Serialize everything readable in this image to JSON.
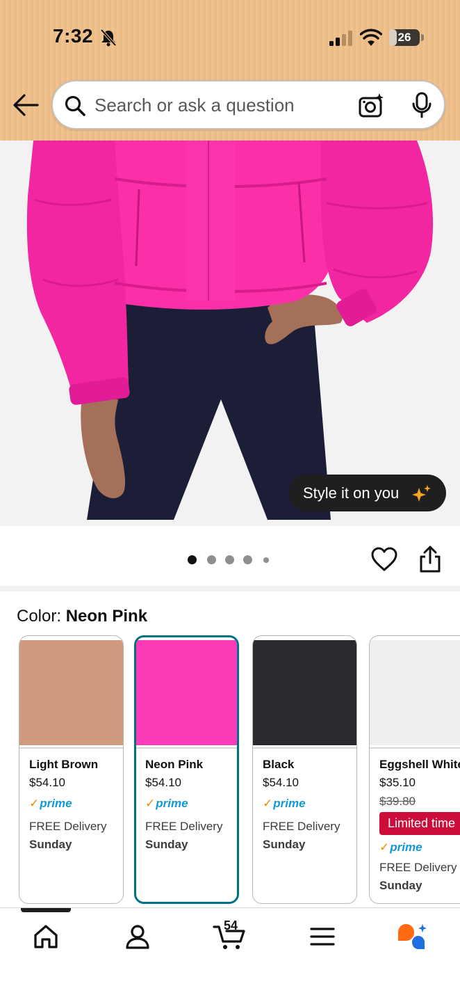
{
  "status_bar": {
    "time": "7:32",
    "battery": "26",
    "battery_level": 0.26
  },
  "search": {
    "placeholder": "Search or ask a question"
  },
  "product": {
    "style_button_label": "Style it on you",
    "image_dots": 5,
    "active_dot": 0
  },
  "color_selector": {
    "label": "Color: ",
    "selected": "Neon Pink",
    "options": [
      {
        "name": "Light Brown",
        "price": "$54.10",
        "prime": "prime",
        "delivery": "FREE Delivery",
        "day": "Sunday",
        "swatch": "#cf9a7f"
      },
      {
        "name": "Neon Pink",
        "price": "$54.10",
        "prime": "prime",
        "delivery": "FREE Delivery",
        "day": "Sunday",
        "swatch": "#fb3cb8"
      },
      {
        "name": "Black",
        "price": "$54.10",
        "prime": "prime",
        "delivery": "FREE Delivery",
        "day": "Sunday",
        "swatch": "#2b2a30"
      },
      {
        "name": "Eggshell White",
        "price": "$35.10",
        "list_price": "$39.80",
        "deal": "Limited time",
        "prime": "prime",
        "delivery": "FREE Delivery",
        "day": "Sunday",
        "swatch": "#efefed"
      }
    ]
  },
  "bottom_nav": {
    "cart_count": "54",
    "items": [
      "home-icon",
      "account-icon",
      "cart-icon",
      "menu-icon",
      "rufus-ai-icon"
    ]
  },
  "colors": {
    "header_bg": "#f0c28f",
    "selected_border": "#007185",
    "prime_blue": "#1399d6",
    "prime_check": "#f08804",
    "deal_red": "#cc0c39",
    "jacket_pink": "#fb2fa8",
    "leggings_navy": "#1c1d36"
  }
}
